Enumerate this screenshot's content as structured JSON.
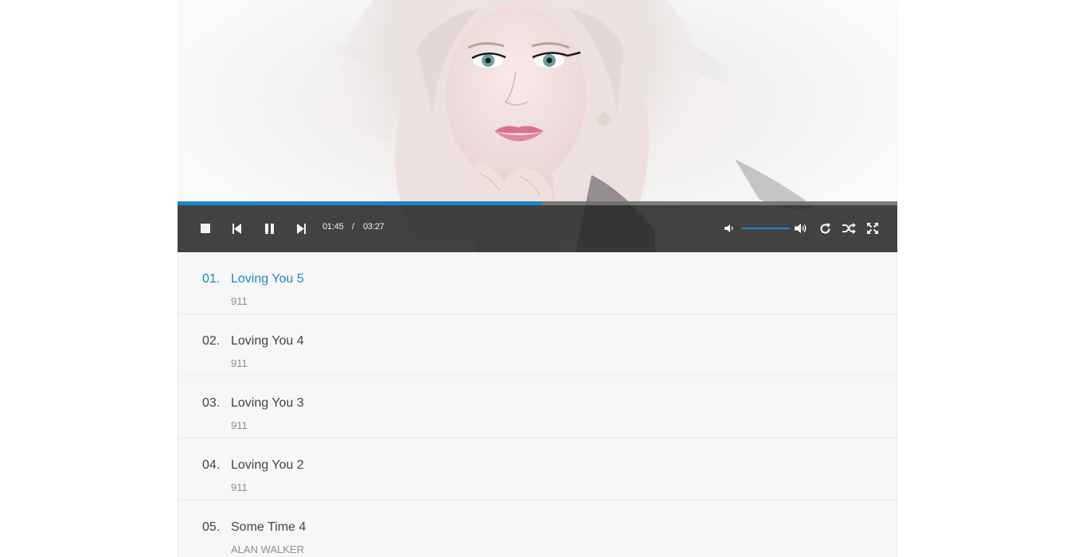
{
  "player": {
    "progress_percent": 50.7,
    "current_time": "01:45",
    "time_separator": "/",
    "duration": "03:27",
    "volume_percent": 100,
    "accent_color": "#1e86c8",
    "icons": {
      "stop": "stop-icon",
      "previous": "previous-icon",
      "pause": "pause-icon",
      "next": "next-icon",
      "volume_low": "volume-low-icon",
      "volume_high": "volume-high-icon",
      "repeat": "repeat-icon",
      "shuffle": "shuffle-icon",
      "fullscreen": "fullscreen-icon"
    }
  },
  "playlist": [
    {
      "number": "01.",
      "title": "Loving You 5",
      "artist": "911",
      "active": true
    },
    {
      "number": "02.",
      "title": "Loving You 4",
      "artist": "911",
      "active": false
    },
    {
      "number": "03.",
      "title": "Loving You 3",
      "artist": "911",
      "active": false
    },
    {
      "number": "04.",
      "title": "Loving You 2",
      "artist": "911",
      "active": false
    },
    {
      "number": "05.",
      "title": "Some Time 4",
      "artist": "ALAN WALKER",
      "active": false
    }
  ]
}
